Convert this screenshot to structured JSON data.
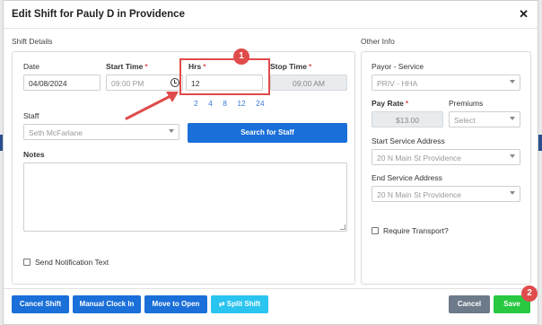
{
  "modal": {
    "title": "Edit Shift for Pauly D in Providence"
  },
  "shift_details": {
    "section_label": "Shift Details",
    "date": {
      "label": "Date",
      "value": "04/08/2024"
    },
    "start_time": {
      "label": "Start Time",
      "value": "09:00 PM"
    },
    "hrs": {
      "label": "Hrs",
      "value": "12",
      "options": [
        "2",
        "4",
        "8",
        "12",
        "24"
      ]
    },
    "stop_time": {
      "label": "Stop Time",
      "value": "09:00 AM"
    },
    "staff": {
      "label": "Staff",
      "value": "Seth McFarlane"
    },
    "search_staff_label": "Search for Staff",
    "notes": {
      "label": "Notes",
      "value": ""
    },
    "send_notification_label": "Send Notification Text",
    "required_mark": "*"
  },
  "other_info": {
    "section_label": "Other Info",
    "payor_service": {
      "label": "Payor - Service",
      "value": "PRIV - HHA"
    },
    "pay_rate": {
      "label": "Pay Rate",
      "value": "$13.00"
    },
    "premiums": {
      "label": "Premiums",
      "value": "Select"
    },
    "start_address": {
      "label": "Start Service Address",
      "value": "20 N Main St Providence"
    },
    "end_address": {
      "label": "End Service Address",
      "value": "20 N Main St Providence"
    },
    "require_transport_label": "Require Transport?"
  },
  "footer": {
    "cancel_shift": "Cancel Shift",
    "manual_clock_in": "Manual Clock In",
    "move_to_open": "Move to Open",
    "split_shift": "Split Shift",
    "cancel": "Cancel",
    "save": "Save"
  },
  "annotations": {
    "step1": "1",
    "step2": "2"
  },
  "colors": {
    "primary": "#1a6fd8",
    "info": "#29c4ef",
    "success": "#28c840",
    "secondary": "#6c7a89",
    "annotation": "#e04b4b",
    "required": "#d9534f"
  },
  "icons": {
    "close": "close-icon",
    "clock": "clock-icon",
    "dropdown": "chevron-down-icon",
    "split": "shuffle-icon"
  }
}
